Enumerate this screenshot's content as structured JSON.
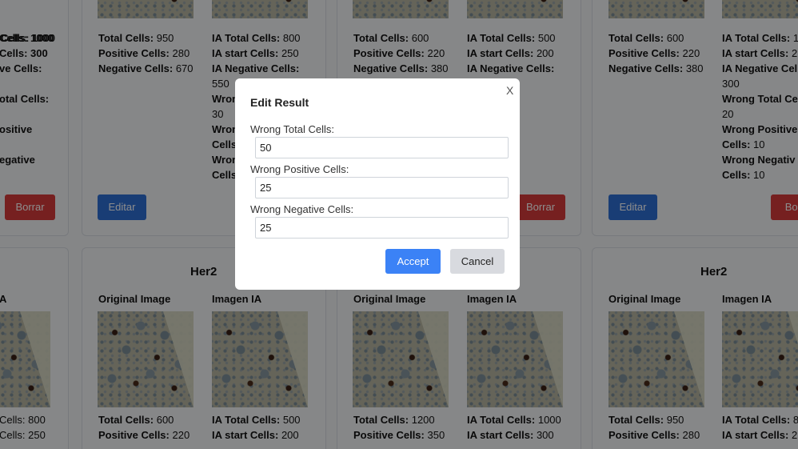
{
  "cards_top": [
    {
      "left_lines": [
        "Cells: 1000",
        "Cells: 300",
        "ve Cells:",
        "",
        "otal Cells:",
        "",
        "ositive",
        "",
        "egative"
      ],
      "right_lines": [],
      "button": "Borrar"
    },
    {
      "left_lines": [
        {
          "label": "Total Cells:",
          "value": " 950"
        },
        {
          "label": "Positive Cells:",
          "value": " 280"
        },
        {
          "label": "Negative Cells:",
          "value": " 670"
        }
      ],
      "right_lines": [
        {
          "label": "IA Total Cells:",
          "value": " 800"
        },
        {
          "label": "IA start Cells:",
          "value": " 250"
        },
        {
          "label": "IA Negative Cells:",
          "value": ""
        },
        {
          "label": "",
          "value": "550"
        },
        {
          "label": "Wron",
          "value": ""
        },
        {
          "label": "",
          "value": "30"
        },
        {
          "label": "Wron",
          "value": ""
        },
        {
          "label": "Cells",
          "value": ""
        },
        {
          "label": "Wron",
          "value": ""
        },
        {
          "label": "Cells",
          "value": ""
        }
      ],
      "button": "Editar"
    },
    {
      "left_lines": [
        {
          "label": "Total Cells:",
          "value": " 600"
        },
        {
          "label": "Positive Cells:",
          "value": " 220"
        },
        {
          "label": "Negative Cells:",
          "value": " 380"
        }
      ],
      "right_lines": [
        {
          "label": "IA Total Cells:",
          "value": " 500"
        },
        {
          "label": "IA start Cells:",
          "value": " 200"
        },
        {
          "label": "IA Negative Cells:",
          "value": ""
        },
        {
          "label": "",
          "value": ""
        },
        {
          "label": "al Cells:",
          "value": ""
        },
        {
          "label": "",
          "value": ""
        },
        {
          "label": "sitive",
          "value": ""
        },
        {
          "label": "",
          "value": ""
        },
        {
          "label": "gative",
          "value": ""
        }
      ],
      "button": "Borrar"
    },
    {
      "left_lines": [
        {
          "label": "Total Cells:",
          "value": " 600"
        },
        {
          "label": "Positive Cells:",
          "value": " 220"
        },
        {
          "label": "Negative Cells:",
          "value": " 380"
        }
      ],
      "right_lines": [
        {
          "label": "IA Total Cells:",
          "value": " 1"
        },
        {
          "label": "IA start Cells:",
          "value": " 2"
        },
        {
          "label": "IA Negative Cells:",
          "value": ""
        },
        {
          "label": "",
          "value": "300"
        },
        {
          "label": "Wrong Total Ce",
          "value": ""
        },
        {
          "label": "",
          "value": "20"
        },
        {
          "label": "Wrong Positive",
          "value": ""
        },
        {
          "label": "Cells:",
          "value": " 10"
        },
        {
          "label": "Wrong Negativ",
          "value": ""
        },
        {
          "label": "Cells:",
          "value": " 10"
        }
      ],
      "buttons": [
        "Editar",
        "Borr"
      ]
    }
  ],
  "cards_bottom": [
    {
      "title": "",
      "label_left": "A",
      "left_lines": [
        {
          "label": "",
          "value": "Cells: 800"
        },
        {
          "label": "",
          "value": "Cells: 250"
        }
      ]
    },
    {
      "title": "Her2",
      "label_left": "Original Image",
      "label_right": "Imagen IA",
      "left_lines": [
        {
          "label": "Total Cells:",
          "value": " 600"
        },
        {
          "label": "Positive Cells:",
          "value": " 220"
        }
      ],
      "right_lines": [
        {
          "label": "IA Total Cells:",
          "value": " 500"
        },
        {
          "label": "IA start Cells:",
          "value": " 200"
        }
      ]
    },
    {
      "title": "",
      "label_left": "Original Image",
      "label_right": "Imagen IA",
      "left_lines": [
        {
          "label": "Total Cells:",
          "value": " 1200"
        },
        {
          "label": "Positive Cells:",
          "value": " 350"
        }
      ],
      "right_lines": [
        {
          "label": "IA Total Cells:",
          "value": " 1000"
        },
        {
          "label": "IA start Cells:",
          "value": " 300"
        }
      ]
    },
    {
      "title": "Her2",
      "label_left": "Original Image",
      "label_right": "Imagen IA",
      "left_lines": [
        {
          "label": "Total Cells:",
          "value": " 950"
        },
        {
          "label": "Positive Cells:",
          "value": " 280"
        }
      ],
      "right_lines": [
        {
          "label": "IA Total Cells:",
          "value": " 8"
        },
        {
          "label": "IA start Cells:",
          "value": " 2"
        }
      ]
    }
  ],
  "modal": {
    "title": "Edit Result",
    "close": "X",
    "fields": [
      {
        "label": "Wrong Total Cells:",
        "value": "50"
      },
      {
        "label": "Wrong Positive Cells:",
        "value": "25"
      },
      {
        "label": "Wrong Negative Cells:",
        "value": "25"
      }
    ],
    "accept": "Accept",
    "cancel": "Cancel"
  },
  "colors": {
    "accept": "#3b82f6",
    "edit": "#2f6fd6",
    "delete": "#d83b3b"
  }
}
